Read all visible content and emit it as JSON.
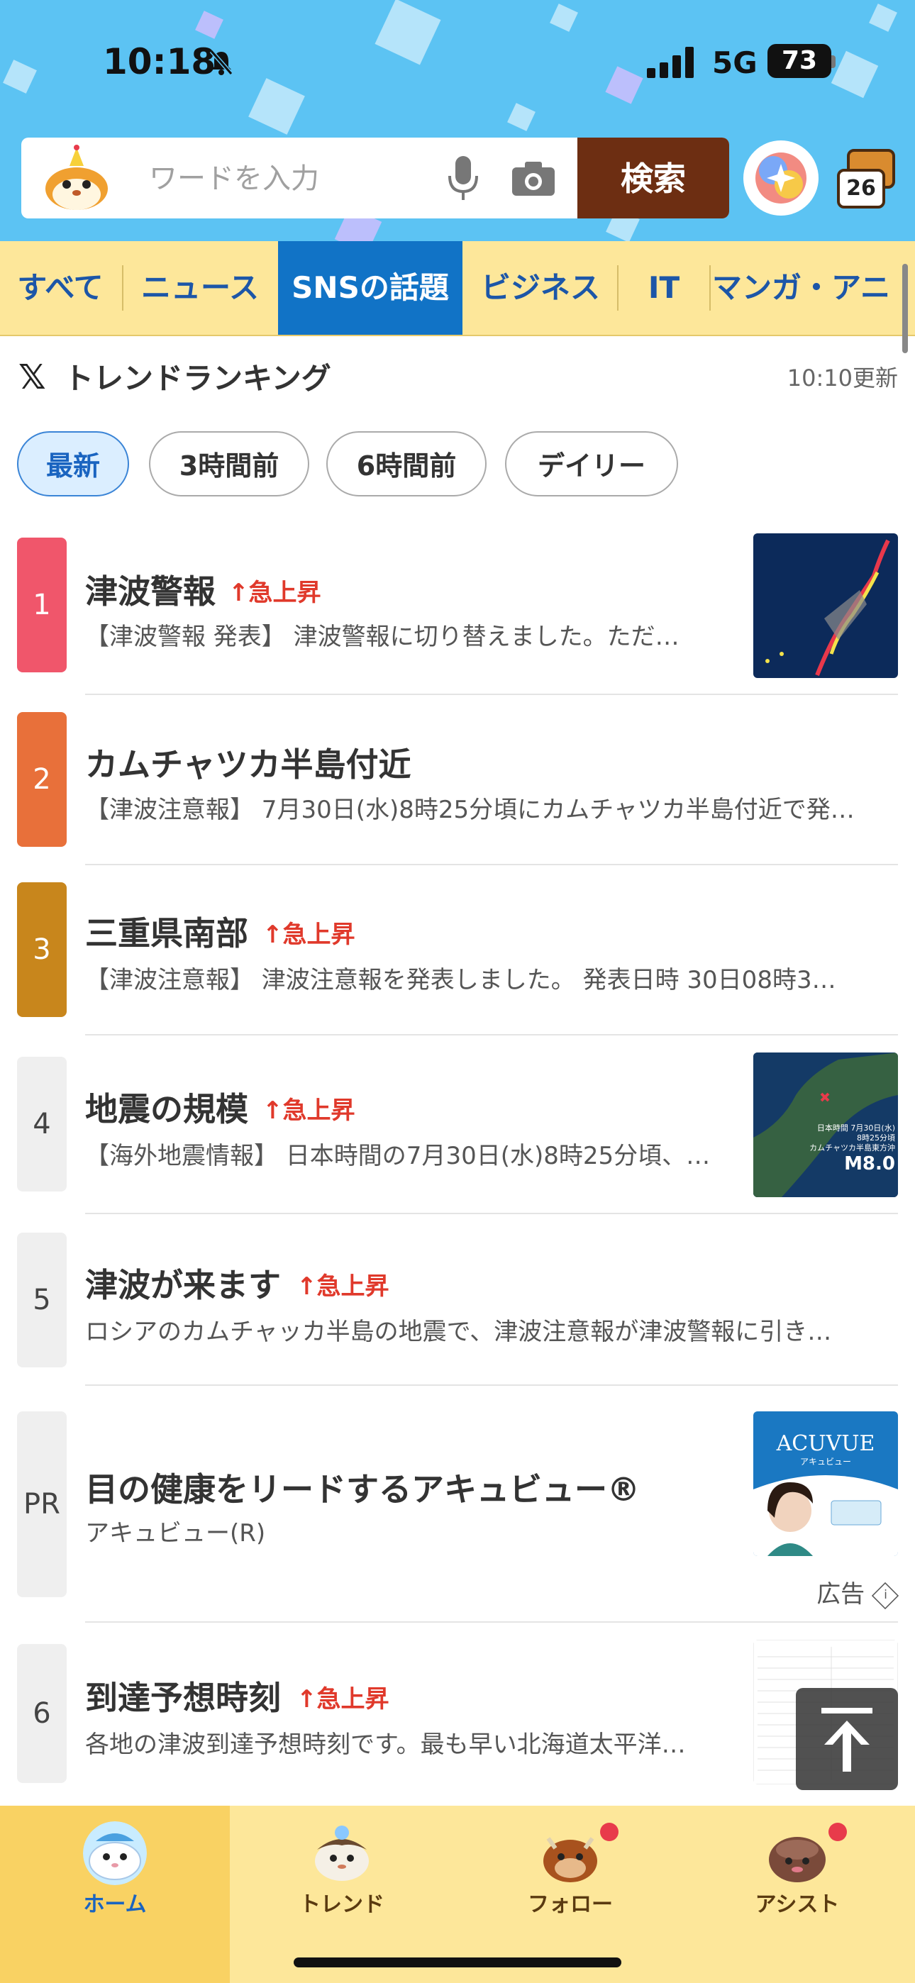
{
  "status_bar": {
    "time": "10:18",
    "network": "5G",
    "battery": "73"
  },
  "search": {
    "placeholder": "ワードを入力",
    "button_label": "検索",
    "tab_count": "26"
  },
  "categories": [
    "すべて",
    "ニュース",
    "SNSの話題",
    "ビジネス",
    "IT",
    "マンガ・アニ"
  ],
  "section": {
    "title": "トレンドランキング",
    "updated": "10:10更新"
  },
  "filters": [
    "最新",
    "3時間前",
    "6時間前",
    "デイリー"
  ],
  "surge_label": "急上昇",
  "ranking": [
    {
      "rank": "1",
      "title": "津波警報",
      "desc": "【津波警報 発表】 津波警報に切り替えました。ただ…",
      "surge": true,
      "color": "#f0566b"
    },
    {
      "rank": "2",
      "title": "カムチャツカ半島付近",
      "desc": "【津波注意報】 7月30日(水)8時25分頃にカムチャツカ半島付近で発…",
      "surge": false,
      "color": "#e8703a"
    },
    {
      "rank": "3",
      "title": "三重県南部",
      "desc": "【津波注意報】 津波注意報を発表しました。 発表日時 30日08時3…",
      "surge": true,
      "color": "#c8861c"
    },
    {
      "rank": "4",
      "title": "地震の規模",
      "desc": "【海外地震情報】 日本時間の7月30日(水)8時25分頃、…",
      "surge": true,
      "color": "#efefef"
    },
    {
      "rank": "5",
      "title": "津波が来ます",
      "desc": "ロシアのカムチャッカ半島の地震で、津波注意報が津波警報に引き…",
      "surge": true,
      "color": "#efefef"
    }
  ],
  "ad": {
    "rank": "PR",
    "title": "目の健康をリードするアキュビュー®",
    "desc": "アキュビュー(R)",
    "label": "広告",
    "brand": "ACUVUE",
    "sub": "アキュビュー"
  },
  "ranking_after_ad": {
    "rank": "6",
    "title": "到達予想時刻",
    "desc": "各地の津波到達予想時刻です。最も早い北海道太平洋…",
    "surge": true
  },
  "thumb4_text": [
    "日本時間 7月30日(水)",
    "8時25分頃",
    "カムチャツカ半島東方沖",
    "M8.0"
  ],
  "nav": [
    {
      "label": "ホーム",
      "active": true
    },
    {
      "label": "トレンド",
      "active": false
    },
    {
      "label": "フォロー",
      "active": false
    },
    {
      "label": "アシスト",
      "active": false
    }
  ]
}
